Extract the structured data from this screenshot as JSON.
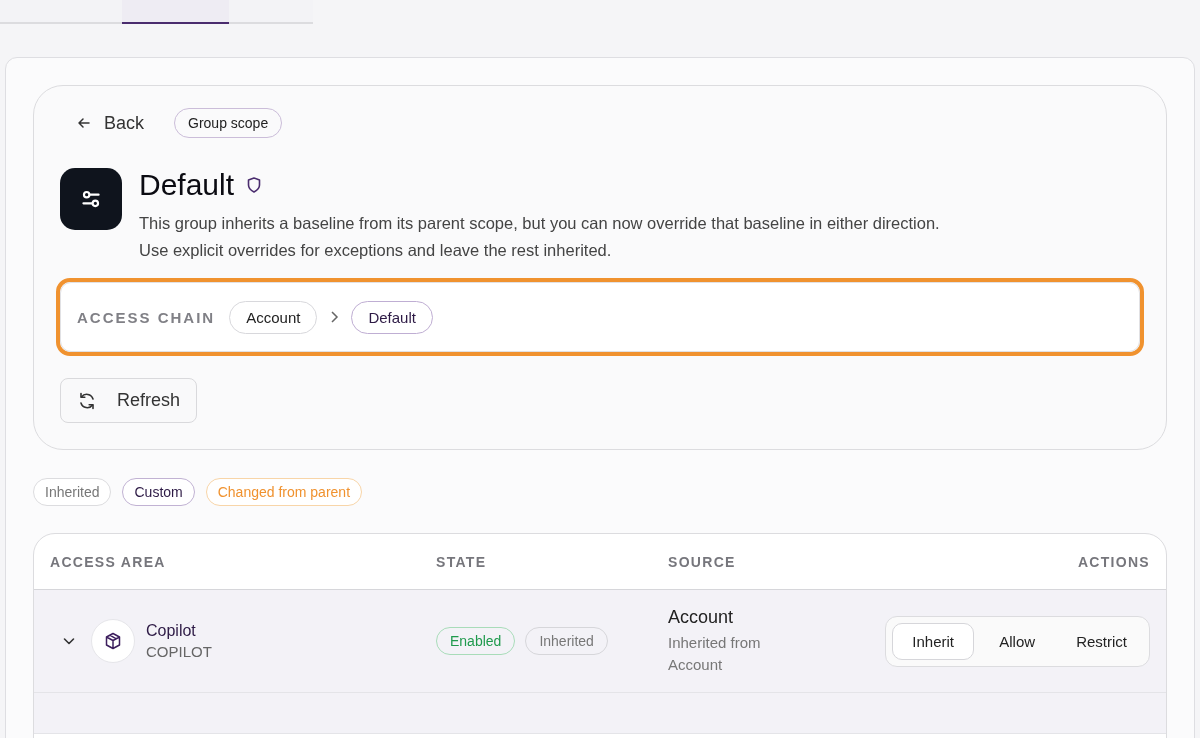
{
  "tabs": [
    {
      "selected": false
    },
    {
      "selected": true
    },
    {
      "selected": false
    }
  ],
  "back": "Back",
  "scope_badge": "Group scope",
  "group": {
    "title": "Default",
    "description": "This group inherits a baseline from its parent scope, but you can now override that baseline in either direction. Use explicit overrides for exceptions and leave the rest inherited."
  },
  "access_chain": {
    "label": "ACCESS CHAIN",
    "highlighted": true,
    "items": [
      {
        "label": "Account",
        "selected": false
      },
      {
        "label": "Default",
        "selected": true
      }
    ]
  },
  "refresh": "Refresh",
  "legend": [
    {
      "label": "Inherited",
      "kind": "inherited"
    },
    {
      "label": "Custom",
      "kind": "custom"
    },
    {
      "label": "Changed from parent",
      "kind": "changed"
    }
  ],
  "table": {
    "columns": [
      "ACCESS AREA",
      "STATE",
      "SOURCE",
      "ACTIONS"
    ],
    "rows": [
      {
        "expanded": true,
        "name": "Copilot",
        "code": "COPILOT",
        "badges": [
          {
            "label": "Enabled",
            "kind": "enabled"
          },
          {
            "label": "Inherited",
            "kind": "inherited"
          }
        ],
        "source": "Account",
        "source_note": "Inherited from Account",
        "actions": [
          {
            "label": "Inherit",
            "selected": true
          },
          {
            "label": "Allow",
            "selected": false
          },
          {
            "label": "Restrict",
            "selected": false
          }
        ]
      }
    ]
  }
}
